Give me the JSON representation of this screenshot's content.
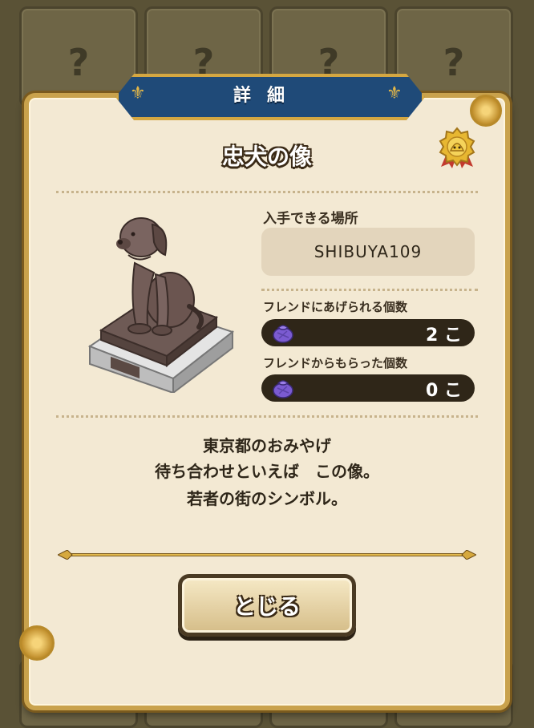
{
  "background": {
    "tile_symbol": "?"
  },
  "header": {
    "title": "詳細"
  },
  "item": {
    "name": "忠犬の像",
    "medal_icon": "slime-medal-icon",
    "image": "hachiko-statue"
  },
  "location": {
    "label": "入手できる場所",
    "value": "SHIBUYA109"
  },
  "counts": [
    {
      "label": "フレンドにあげられる個数",
      "value": "2 こ",
      "icon": "purple-bundle-icon"
    },
    {
      "label": "フレンドからもらった個数",
      "value": "0 こ",
      "icon": "purple-bundle-icon"
    }
  ],
  "description": {
    "line1": "東京都のおみやげ",
    "line2": "待ち合わせといえば　この像。",
    "line3": "若者の街のシンボル。"
  },
  "close_button": {
    "label": "とじる"
  },
  "colors": {
    "banner": "#1f4a78",
    "panel": "#f3e9d3",
    "frame_gold": "#c9a24c",
    "count_bar": "#2f2618"
  }
}
